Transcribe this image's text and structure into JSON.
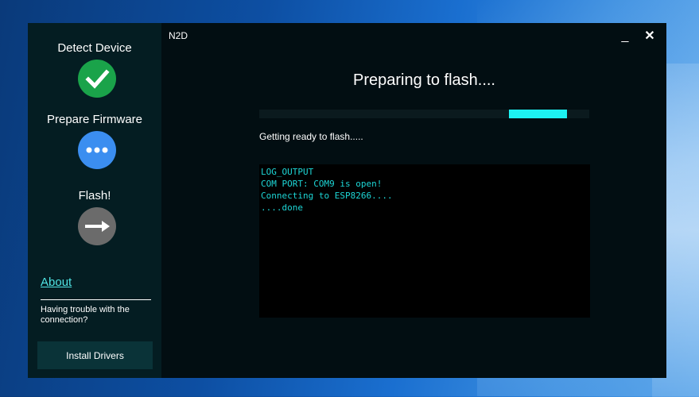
{
  "window": {
    "title": "N2D",
    "minimize_label": "_",
    "close_label": "✕"
  },
  "sidebar": {
    "steps": [
      {
        "label": "Detect Device",
        "icon": "check-icon",
        "color": "#1aa34a",
        "state": "done"
      },
      {
        "label": "Prepare Firmware",
        "icon": "ellipsis-icon",
        "color": "#3b8ef0",
        "state": "active"
      },
      {
        "label": "Flash!",
        "icon": "arrow-right-icon",
        "color": "#6b6b6b",
        "state": "pending"
      }
    ],
    "about_link": "About",
    "trouble_text": "Having trouble with the connection?",
    "install_button": "Install Drivers"
  },
  "main": {
    "heading": "Preparing to flash....",
    "progress": {
      "start": 0.757,
      "end": 0.933,
      "color": "#1df2f2"
    },
    "status": "Getting ready to flash.....",
    "log": [
      "LOG_OUTPUT",
      "COM PORT: COM9 is open!",
      "Connecting to ESP8266....",
      "....done"
    ]
  }
}
